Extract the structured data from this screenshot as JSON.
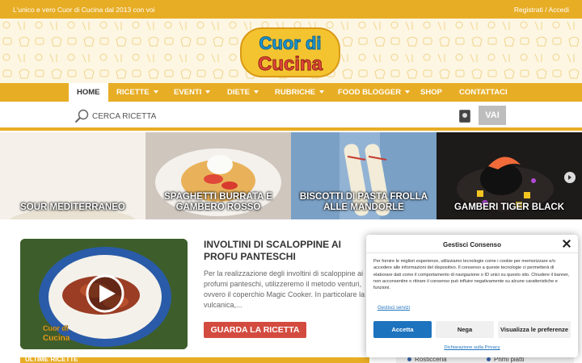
{
  "topbar": {
    "tagline": "L'unico e vero Cuor di Cucina dal 2013 con voi",
    "register": "Registrati",
    "separator": "/",
    "login": "Accedi"
  },
  "logo": {
    "line1": "Cuor di",
    "line2": "Cucina"
  },
  "nav": {
    "items": [
      {
        "label": "HOME",
        "active": true,
        "dropdown": false
      },
      {
        "label": "RICETTE",
        "dropdown": true
      },
      {
        "label": "EVENTI",
        "dropdown": true
      },
      {
        "label": "DIETE",
        "dropdown": true
      },
      {
        "label": "RUBRICHE",
        "dropdown": true
      },
      {
        "label": "FOOD BLOGGER",
        "dropdown": true
      },
      {
        "label": "SHOP",
        "dropdown": false
      },
      {
        "label": "CONTATTACI",
        "dropdown": false
      }
    ]
  },
  "search": {
    "placeholder": "CERCA RICETTA",
    "button": "VAI"
  },
  "slider": {
    "slides": [
      "SOUR MEDITERRANEO",
      "SPAGHETTI BURRATA E GAMBERO ROSSO",
      "BISCOTTI DI PASTA FROLLA ALLE MANDORLE",
      "GAMBERI TIGER BLACK"
    ]
  },
  "featured": {
    "title": "INVOLTINI DI SCALOPPINE AI PROFU PANTESCHI",
    "text": "Per la realizzazione degli involtini di scaloppine ai profumi panteschi,  utilizzeremo il metodo venturi, ovvero il coperchio Magic Cooker. In particolare la vulcanica,...",
    "button": "GUARDA LA RICETTA",
    "watermark_line1": "Cuor di",
    "watermark_line2": "Cucina"
  },
  "bottom": {
    "section": "ULTIME RICETTE",
    "categories": [
      "Rosticceria",
      "Primi piatti"
    ]
  },
  "consent": {
    "title": "Gestisci Consenso",
    "body": "Per fornire le migliori esperienze, utilizziamo tecnologie come i cookie per memorizzare e/o accedere alle informazioni del dispositivo. Il consenso a queste tecnologie ci permetterà di elaborare dati come il comportamento di navigazione o ID unici su questo sito. Chiudere il banner, non acconsentire o ritirare il consenso può influire negativamente su alcune caratteristiche e funzioni.",
    "manage": "Gestisci servizi",
    "accept": "Accetta",
    "deny": "Nega",
    "preferences": "Visualizza le preferenze",
    "policy": "Dichiarazione sulla Privacy"
  },
  "colors": {
    "brand_yellow": "#e7ad25",
    "cta_red": "#d34b3f",
    "consent_blue": "#1e73be"
  }
}
